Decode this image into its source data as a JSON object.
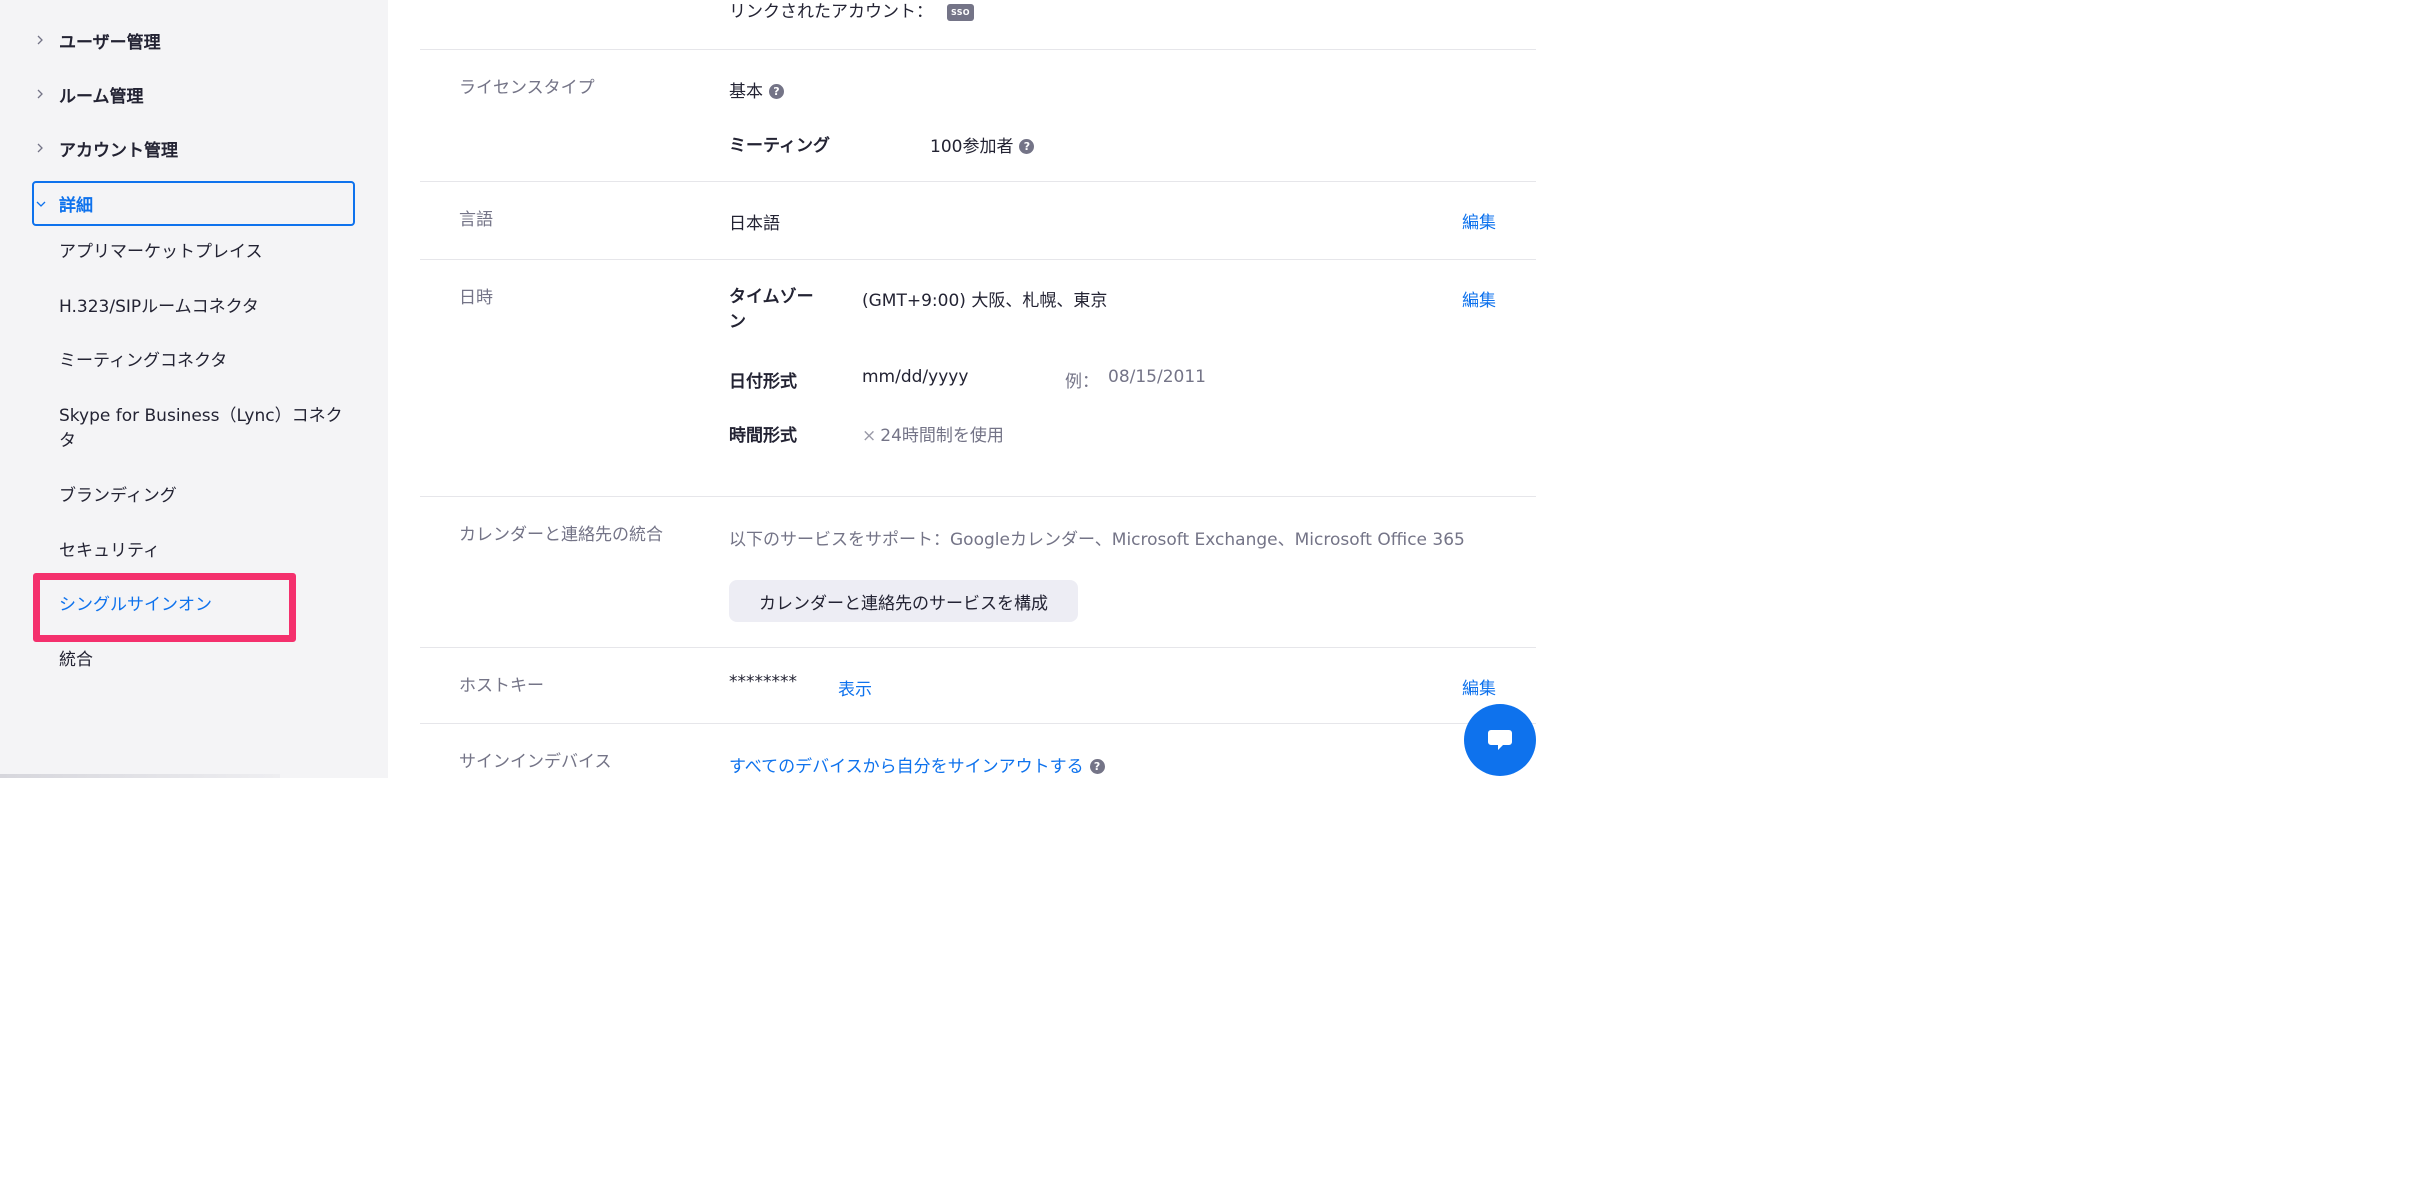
{
  "sidebar": {
    "groups": [
      {
        "label": "ユーザー管理"
      },
      {
        "label": "ルーム管理"
      },
      {
        "label": "アカウント管理"
      },
      {
        "label": "詳細"
      }
    ],
    "items": [
      {
        "label": "アプリマーケットプレイス"
      },
      {
        "label": "H.323/SIPルームコネクタ"
      },
      {
        "label": "ミーティングコネクタ"
      },
      {
        "label": "Skype for Business（Lync）コネクタ"
      },
      {
        "label": "ブランディング"
      },
      {
        "label": "セキュリティ"
      },
      {
        "label": "シングルサインオン"
      },
      {
        "label": "統合"
      }
    ]
  },
  "main": {
    "linked": {
      "label": "リンクされたアカウント：",
      "badge": "SSO"
    },
    "license": {
      "label": "ライセンスタイプ",
      "type": "基本",
      "meeting_label": "ミーティング",
      "meeting_value": "100参加者"
    },
    "language": {
      "label": "言語",
      "value": "日本語",
      "edit": "編集"
    },
    "datetime": {
      "label": "日時",
      "timezone_label": "タイムゾーン",
      "timezone_value": "(GMT+9:00) 大阪、札幌、東京",
      "dateformat_label": "日付形式",
      "dateformat_value": "mm/dd/yyyy",
      "example_label": "例：",
      "example_value": "08/15/2011",
      "timeformat_label": "時間形式",
      "timeformat_value": "24時間制を使用",
      "edit": "編集"
    },
    "calendar": {
      "label": "カレンダーと連絡先の統合",
      "description": "以下のサービスをサポート：Googleカレンダー、Microsoft Exchange、Microsoft Office 365",
      "button": "カレンダーと連絡先のサービスを構成"
    },
    "hostkey": {
      "label": "ホストキー",
      "value": "********",
      "show": "表示",
      "edit": "編集"
    },
    "signin": {
      "label": "サインインデバイス",
      "link": "すべてのデバイスから自分をサインアウトする"
    }
  },
  "icons": {
    "help": "?",
    "chevron_right": "chevron-right-icon",
    "chevron_down": "chevron-down-icon",
    "close": "×"
  },
  "colors": {
    "accent": "#0e72ed",
    "highlight": "#f4306d",
    "sidebar_bg": "#f4f4f6"
  }
}
